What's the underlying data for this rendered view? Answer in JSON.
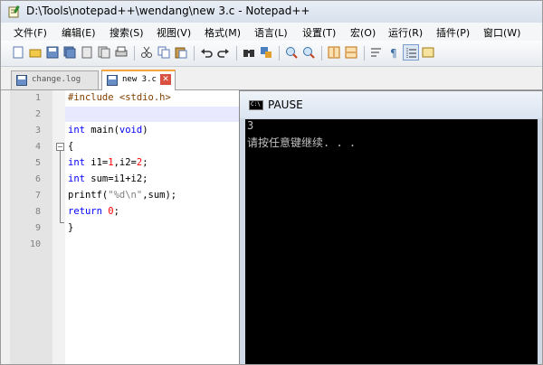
{
  "window": {
    "title": "D:\\Tools\\notepad++\\wendang\\new  3.c - Notepad++"
  },
  "menu": [
    "文件(F)",
    "编辑(E)",
    "搜索(S)",
    "视图(V)",
    "格式(M)",
    "语言(L)",
    "设置(T)",
    "宏(O)",
    "运行(R)",
    "插件(P)",
    "窗口(W)"
  ],
  "toolbar_icons": [
    "new-file-icon",
    "open-file-icon",
    "save-icon",
    "save-all-icon",
    "close-icon",
    "close-all-icon",
    "print-icon",
    "cut-icon",
    "copy-icon",
    "paste-icon",
    "undo-icon",
    "redo-icon",
    "find-icon",
    "replace-icon",
    "zoom-in-icon",
    "zoom-out-icon",
    "sync-vertical-icon",
    "sync-horizontal-icon",
    "word-wrap-icon",
    "show-all-characters-icon",
    "indent-guide-icon",
    "user-language-icon"
  ],
  "tabs": [
    {
      "label": "change.log",
      "active": false
    },
    {
      "label": "new  3.c",
      "active": true
    }
  ],
  "editor": {
    "line_numbers": [
      "1",
      "2",
      "3",
      "4",
      "5",
      "6",
      "7",
      "8",
      "9",
      "10"
    ],
    "current_line": 2,
    "lines": {
      "l1": "#include <stdio.h>",
      "l3_kw": "int",
      "l3_rest": " main(",
      "l3_void": "void",
      "l3_end": ")",
      "l4": "{",
      "l5_kw": "int",
      "l5_a": " i1=",
      "l5_n1": "1",
      "l5_b": ",i2=",
      "l5_n2": "2",
      "l5_c": ";",
      "l6_kw": "int",
      "l6_rest": " sum=i1+i2;",
      "l7_a": "printf(",
      "l7_str": "\"%d\\n\"",
      "l7_b": ",sum);",
      "l8_kw": "return",
      "l8_sp": " ",
      "l8_num": "0",
      "l8_end": ";",
      "l9": "}"
    }
  },
  "console": {
    "title": "PAUSE",
    "output": [
      "3",
      "请按任意键继续. . ."
    ]
  }
}
